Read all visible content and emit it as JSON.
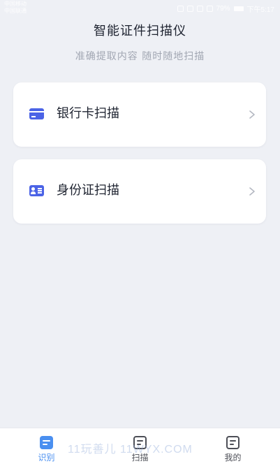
{
  "status_bar": {
    "carrier_line1": "中国移动",
    "carrier_line2": "中国联通",
    "battery": "79%",
    "time": "下午5:17"
  },
  "header": {
    "title": "智能证件扫描仪",
    "subtitle": "准确提取内容 随时随地扫描"
  },
  "cards": [
    {
      "label": "银行卡扫描",
      "icon": "bank-card-icon"
    },
    {
      "label": "身份证扫描",
      "icon": "id-card-icon"
    }
  ],
  "tab_bar": {
    "tabs": [
      {
        "label": "识别",
        "active": true,
        "icon": "recognize-icon"
      },
      {
        "label": "扫描",
        "active": false,
        "icon": "scan-icon"
      },
      {
        "label": "我的",
        "active": false,
        "icon": "profile-icon"
      }
    ]
  },
  "watermark": "11玩善儿 11WYX.COM",
  "colors": {
    "accent": "#4a8ff0",
    "card_icon": "#4b63e6",
    "background": "#eef0f5",
    "text_primary": "#1e2330",
    "text_secondary": "#a2a7b3"
  }
}
